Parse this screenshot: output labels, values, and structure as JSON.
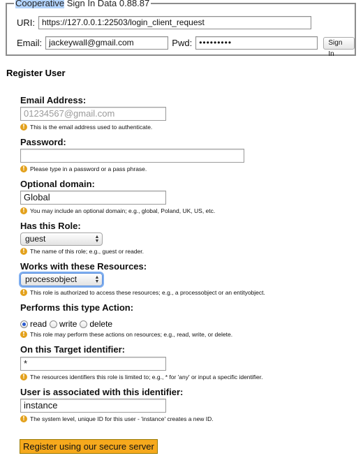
{
  "signin": {
    "legend_selected": "Cooperative",
    "legend_rest": " Sign In Data 0.88.87",
    "uri_label": "URI:",
    "uri_value": "https://127.0.0.1:22503/login_client_request",
    "email_label": "Email:",
    "email_value": "jackeywall@gmail.com",
    "pwd_label": "Pwd:",
    "pwd_value": "•••••••••",
    "signin_button": "Sign In"
  },
  "form": {
    "title": "Register User",
    "email": {
      "label": "Email Address:",
      "placeholder": "01234567@gmail.com",
      "hint": "This is the email address used to authenticate."
    },
    "password": {
      "label": "Password:",
      "value": "",
      "hint": "Please type in a password or a pass phrase."
    },
    "domain": {
      "label": "Optional domain:",
      "value": "Global",
      "hint": "You may include an optional domain; e.g., global, Poland, UK, US, etc."
    },
    "role": {
      "label": "Has this Role:",
      "selected": "guest",
      "hint": "The name of this role; e.g., guest or reader."
    },
    "resources": {
      "label": "Works with these Resources:",
      "selected": "processobject",
      "hint": "This role is authorized to access these resources; e.g., a processobject or an entityobject."
    },
    "action": {
      "label": "Performs this type Action:",
      "options": [
        "read",
        "write",
        "delete"
      ],
      "selected": "read",
      "hint": "This role may perform these actions on resources; e.g., read, write, or delete."
    },
    "target": {
      "label": "On this Target identifier:",
      "value": "*",
      "hint": "The resources identifiers this role is limited to; e.g., * for 'any' or input a specific identifier."
    },
    "identifier": {
      "label": "User is associated with this identifier:",
      "value": "instance",
      "hint": "The system level, unique ID for this user - 'instance' creates a new ID."
    },
    "submit_label": "Register using our secure server"
  },
  "icons": {
    "info": "info-icon",
    "select_arrows": "up-down-arrows-icon"
  },
  "colors": {
    "info_icon": "#e3a11c",
    "submit_button": "#f6a91d",
    "selection": "#b3d4fd"
  }
}
